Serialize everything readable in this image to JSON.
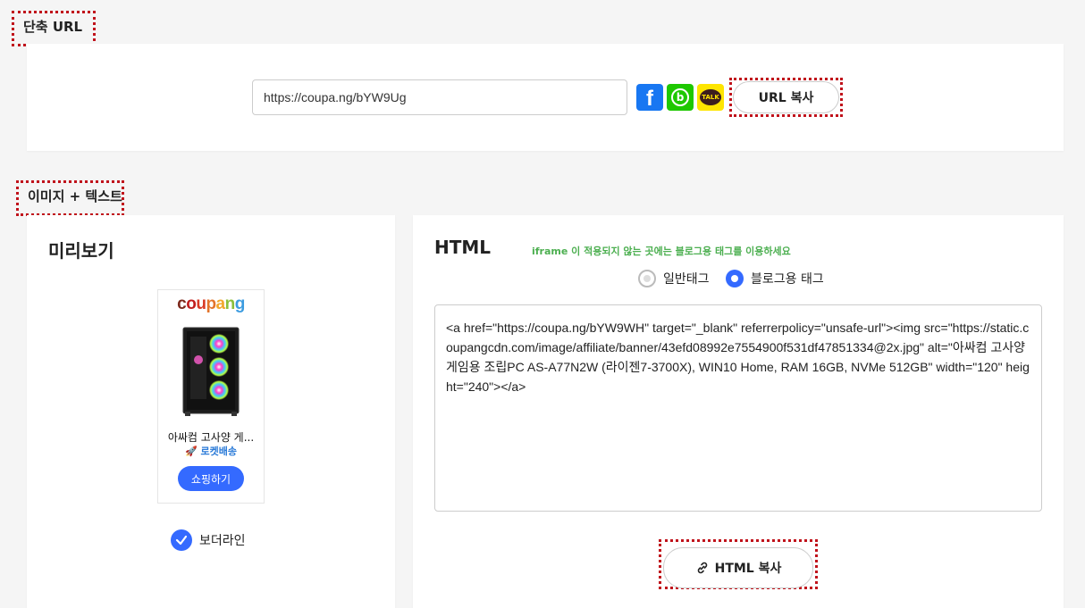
{
  "short_url_section": {
    "label": "단축 URL",
    "url_value": "https://coupa.ng/bYW9Ug",
    "copy_button": "URL 복사",
    "share_icons": [
      "facebook-icon",
      "band-icon",
      "kakaotalk-icon"
    ],
    "kakao_text": "TALK"
  },
  "image_text_section": {
    "label": "이미지 + 텍스트",
    "preview": {
      "title": "미리보기",
      "product": {
        "logo_letters": [
          "c",
          "o",
          "u",
          "p",
          "a",
          "n",
          "g"
        ],
        "name": "아싸컴 고사양 게...",
        "delivery": "🚀 로켓배송",
        "shop_button": "쇼핑하기"
      },
      "border_option": "보더라인"
    },
    "html": {
      "title": "HTML",
      "notice": "iframe 이 적용되지 않는 곳에는 블로그용 태그를 이용하세요",
      "radio_options": [
        {
          "label": "일반태그",
          "selected": false
        },
        {
          "label": "블로그용 태그",
          "selected": true
        }
      ],
      "code": "<a href=\"https://coupa.ng/bYW9WH\" target=\"_blank\" referrerpolicy=\"unsafe-url\"><img src=\"https://static.coupangcdn.com/image/affiliate/banner/43efd08992e7554900f531df47851334@2x.jpg\" alt=\"아싸컴 고사양 게임용 조립PC AS-A77N2W (라이젠7-3700X), WIN10 Home, RAM 16GB, NVMe 512GB\" width=\"120\" height=\"240\"></a>",
      "copy_button": "HTML 복사"
    }
  },
  "colors": {
    "accent": "#346aff",
    "annotation": "#c0121b",
    "notice": "#4caf50",
    "facebook": "#1877f2",
    "band": "#1ec800",
    "kakao": "#fee500"
  }
}
